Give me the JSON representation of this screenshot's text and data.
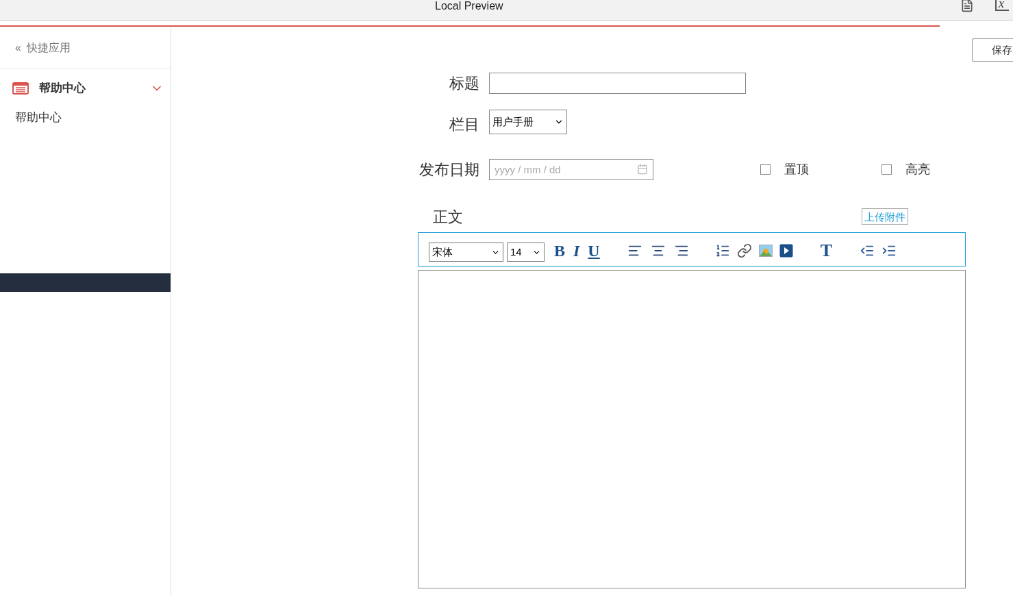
{
  "window": {
    "title": "Local Preview",
    "formula_char": "x"
  },
  "sidebar": {
    "back": {
      "icon_char": "«",
      "label": "快捷应用"
    },
    "groups": [
      {
        "label": "帮助中心",
        "expanded": true,
        "children": [
          {
            "label": "帮助中心"
          }
        ]
      }
    ]
  },
  "save_button": "保存",
  "form": {
    "title": {
      "label": "标题"
    },
    "column": {
      "label": "栏目",
      "value": "用户手册"
    },
    "date": {
      "label": "发布日期",
      "placeholder": "yyyy / mm / dd"
    },
    "options": [
      {
        "label": "置顶",
        "checked": false
      },
      {
        "label": "高亮",
        "checked": false
      }
    ],
    "body": {
      "label": "正文",
      "upload_button": "上传附件"
    },
    "toolbar": {
      "font": "宋体",
      "size": "14",
      "formats": [
        {
          "kind": "bold",
          "char": "B"
        },
        {
          "kind": "italic",
          "char": "I"
        },
        {
          "kind": "underline",
          "char": "U"
        }
      ],
      "text_style": "T"
    }
  }
}
